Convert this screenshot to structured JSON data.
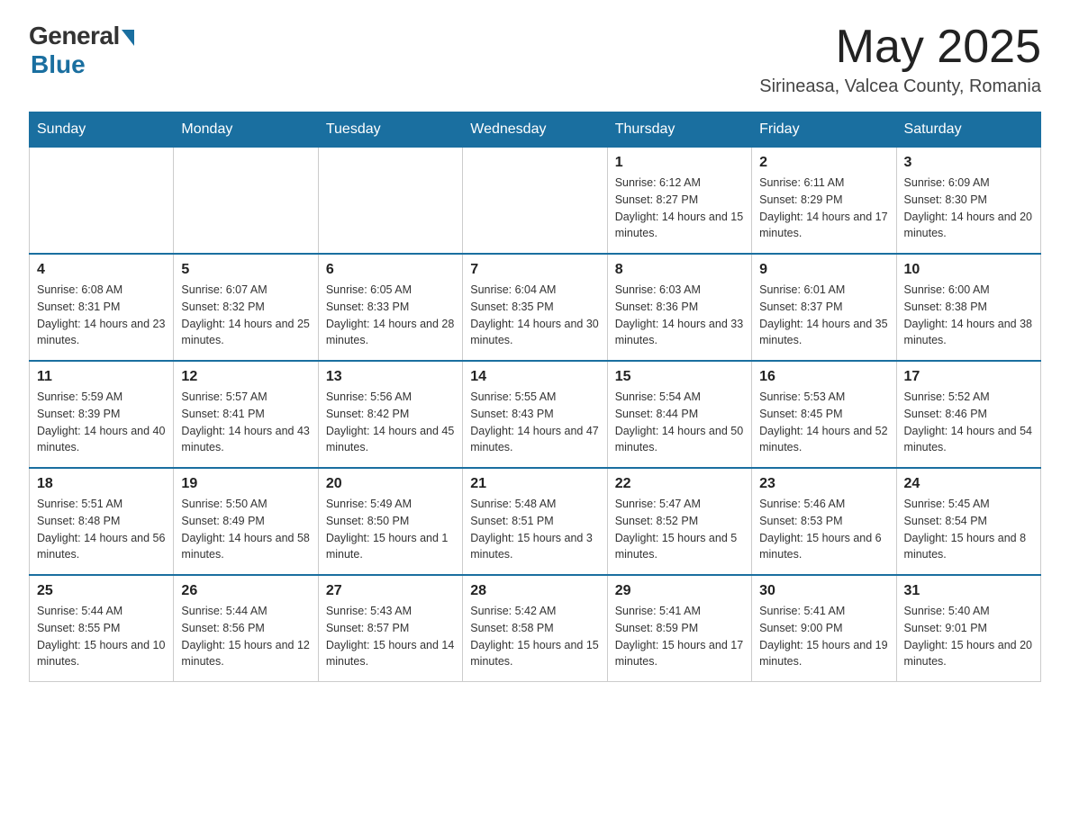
{
  "logo": {
    "general": "General",
    "blue": "Blue"
  },
  "header": {
    "month": "May 2025",
    "location": "Sirineasa, Valcea County, Romania"
  },
  "weekdays": [
    "Sunday",
    "Monday",
    "Tuesday",
    "Wednesday",
    "Thursday",
    "Friday",
    "Saturday"
  ],
  "weeks": [
    [
      {
        "day": "",
        "info": ""
      },
      {
        "day": "",
        "info": ""
      },
      {
        "day": "",
        "info": ""
      },
      {
        "day": "",
        "info": ""
      },
      {
        "day": "1",
        "info": "Sunrise: 6:12 AM\nSunset: 8:27 PM\nDaylight: 14 hours and 15 minutes."
      },
      {
        "day": "2",
        "info": "Sunrise: 6:11 AM\nSunset: 8:29 PM\nDaylight: 14 hours and 17 minutes."
      },
      {
        "day": "3",
        "info": "Sunrise: 6:09 AM\nSunset: 8:30 PM\nDaylight: 14 hours and 20 minutes."
      }
    ],
    [
      {
        "day": "4",
        "info": "Sunrise: 6:08 AM\nSunset: 8:31 PM\nDaylight: 14 hours and 23 minutes."
      },
      {
        "day": "5",
        "info": "Sunrise: 6:07 AM\nSunset: 8:32 PM\nDaylight: 14 hours and 25 minutes."
      },
      {
        "day": "6",
        "info": "Sunrise: 6:05 AM\nSunset: 8:33 PM\nDaylight: 14 hours and 28 minutes."
      },
      {
        "day": "7",
        "info": "Sunrise: 6:04 AM\nSunset: 8:35 PM\nDaylight: 14 hours and 30 minutes."
      },
      {
        "day": "8",
        "info": "Sunrise: 6:03 AM\nSunset: 8:36 PM\nDaylight: 14 hours and 33 minutes."
      },
      {
        "day": "9",
        "info": "Sunrise: 6:01 AM\nSunset: 8:37 PM\nDaylight: 14 hours and 35 minutes."
      },
      {
        "day": "10",
        "info": "Sunrise: 6:00 AM\nSunset: 8:38 PM\nDaylight: 14 hours and 38 minutes."
      }
    ],
    [
      {
        "day": "11",
        "info": "Sunrise: 5:59 AM\nSunset: 8:39 PM\nDaylight: 14 hours and 40 minutes."
      },
      {
        "day": "12",
        "info": "Sunrise: 5:57 AM\nSunset: 8:41 PM\nDaylight: 14 hours and 43 minutes."
      },
      {
        "day": "13",
        "info": "Sunrise: 5:56 AM\nSunset: 8:42 PM\nDaylight: 14 hours and 45 minutes."
      },
      {
        "day": "14",
        "info": "Sunrise: 5:55 AM\nSunset: 8:43 PM\nDaylight: 14 hours and 47 minutes."
      },
      {
        "day": "15",
        "info": "Sunrise: 5:54 AM\nSunset: 8:44 PM\nDaylight: 14 hours and 50 minutes."
      },
      {
        "day": "16",
        "info": "Sunrise: 5:53 AM\nSunset: 8:45 PM\nDaylight: 14 hours and 52 minutes."
      },
      {
        "day": "17",
        "info": "Sunrise: 5:52 AM\nSunset: 8:46 PM\nDaylight: 14 hours and 54 minutes."
      }
    ],
    [
      {
        "day": "18",
        "info": "Sunrise: 5:51 AM\nSunset: 8:48 PM\nDaylight: 14 hours and 56 minutes."
      },
      {
        "day": "19",
        "info": "Sunrise: 5:50 AM\nSunset: 8:49 PM\nDaylight: 14 hours and 58 minutes."
      },
      {
        "day": "20",
        "info": "Sunrise: 5:49 AM\nSunset: 8:50 PM\nDaylight: 15 hours and 1 minute."
      },
      {
        "day": "21",
        "info": "Sunrise: 5:48 AM\nSunset: 8:51 PM\nDaylight: 15 hours and 3 minutes."
      },
      {
        "day": "22",
        "info": "Sunrise: 5:47 AM\nSunset: 8:52 PM\nDaylight: 15 hours and 5 minutes."
      },
      {
        "day": "23",
        "info": "Sunrise: 5:46 AM\nSunset: 8:53 PM\nDaylight: 15 hours and 6 minutes."
      },
      {
        "day": "24",
        "info": "Sunrise: 5:45 AM\nSunset: 8:54 PM\nDaylight: 15 hours and 8 minutes."
      }
    ],
    [
      {
        "day": "25",
        "info": "Sunrise: 5:44 AM\nSunset: 8:55 PM\nDaylight: 15 hours and 10 minutes."
      },
      {
        "day": "26",
        "info": "Sunrise: 5:44 AM\nSunset: 8:56 PM\nDaylight: 15 hours and 12 minutes."
      },
      {
        "day": "27",
        "info": "Sunrise: 5:43 AM\nSunset: 8:57 PM\nDaylight: 15 hours and 14 minutes."
      },
      {
        "day": "28",
        "info": "Sunrise: 5:42 AM\nSunset: 8:58 PM\nDaylight: 15 hours and 15 minutes."
      },
      {
        "day": "29",
        "info": "Sunrise: 5:41 AM\nSunset: 8:59 PM\nDaylight: 15 hours and 17 minutes."
      },
      {
        "day": "30",
        "info": "Sunrise: 5:41 AM\nSunset: 9:00 PM\nDaylight: 15 hours and 19 minutes."
      },
      {
        "day": "31",
        "info": "Sunrise: 5:40 AM\nSunset: 9:01 PM\nDaylight: 15 hours and 20 minutes."
      }
    ]
  ]
}
